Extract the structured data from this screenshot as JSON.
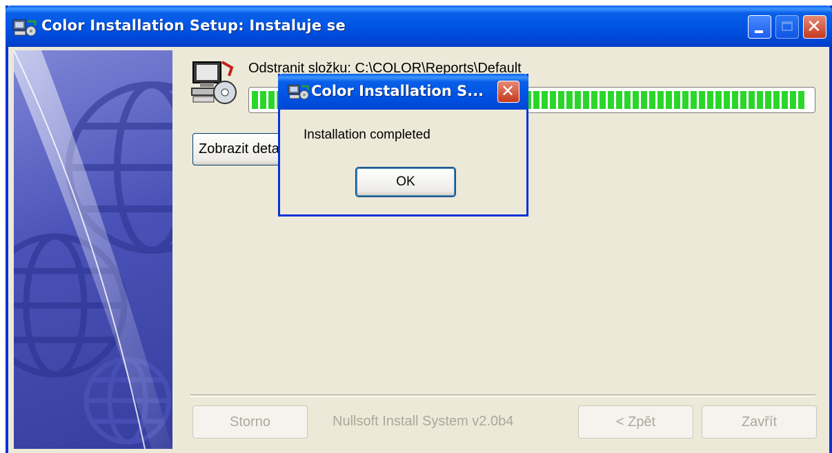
{
  "window": {
    "title": "Color Installation Setup: Instaluje se",
    "controls": [
      "minimize",
      "maximize",
      "close"
    ]
  },
  "content": {
    "status_text": "Odstranit složku: C:\\COLOR\\Reports\\Default",
    "progress": 0.99,
    "details_button_label": "Zobrazit detaily"
  },
  "footer": {
    "cancel_label": "Storno",
    "branding": "Nullsoft Install System v2.0b4",
    "back_label": "< Zpět",
    "close_label": "Zavřít"
  },
  "dialog": {
    "title": "Color Installation S...",
    "message": "Installation completed",
    "ok_label": "OK"
  },
  "colors": {
    "title_bar": "#0055e5",
    "window_bg": "#ece9d8",
    "progress_fill": "#2bd62b",
    "close_button": "#c5381e"
  }
}
